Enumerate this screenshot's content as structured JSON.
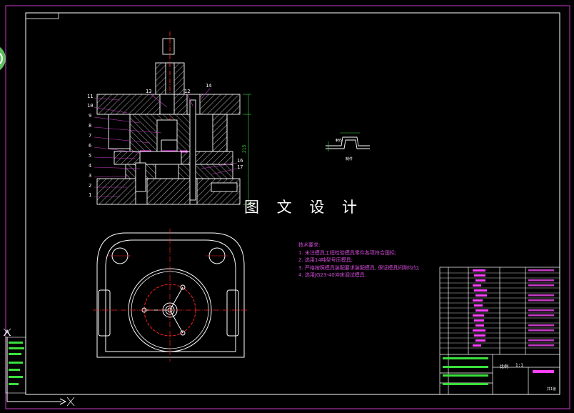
{
  "watermark": "图 文 设 计",
  "technical_requirements": {
    "heading": "技术要求:",
    "items": [
      "1. 未注模具工程检验模具零件各项符合国标;",
      "2. 选用14吨型号压模具;",
      "3. 严格按照模具装配要求装配模具, 保证模具间隙均匀;",
      "4. 选用JG23-40冲床调试模具."
    ]
  },
  "callouts": {
    "left": [
      "11",
      "10",
      "9",
      "8",
      "7",
      "6",
      "5",
      "4",
      "3",
      "2",
      "1"
    ],
    "top": [
      "13",
      "12",
      "14"
    ],
    "right": [
      "16",
      "17"
    ]
  },
  "detail_view": {
    "label": "制件",
    "dim": "Φ85"
  },
  "title_block": {
    "scale": "比例",
    "scale_value": "1:1",
    "sheet": "共1张"
  },
  "colors": {
    "background": "#000000",
    "outline": "#ffffff",
    "frame": "#c83cc8",
    "centerline": "#ff2020",
    "notes": "#d24ad8",
    "dimension": "#3ce03c",
    "text_highlight": "#ff40ff"
  },
  "icons": [
    "ucs-axis-icon",
    "side-tab-icon"
  ]
}
